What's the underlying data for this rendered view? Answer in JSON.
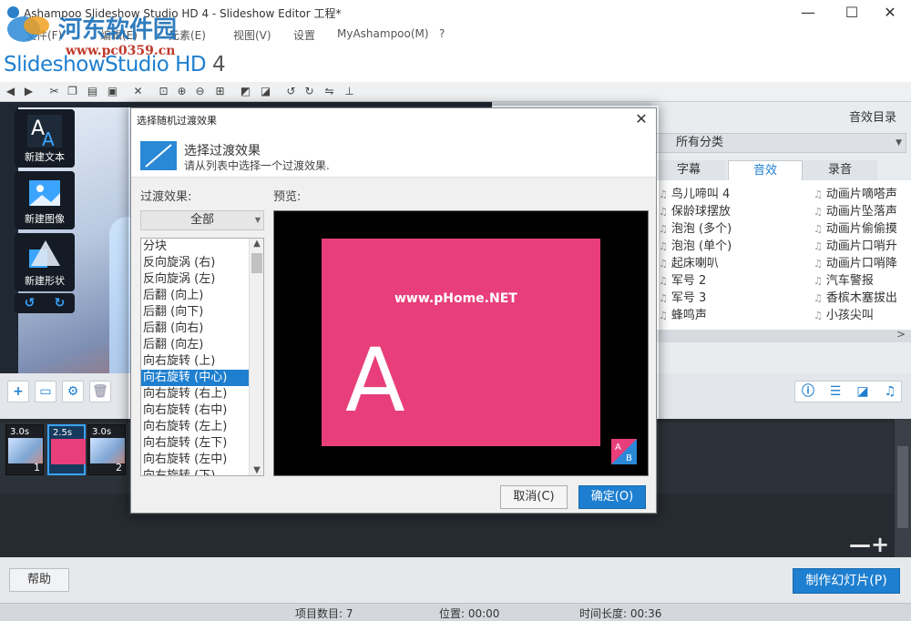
{
  "window": {
    "title": "Ashampoo Slideshow Studio HD 4 - Slideshow Editor 工程*",
    "min_glyph": "—",
    "max_glyph": "☐",
    "close_glyph": "✕"
  },
  "watermark": {
    "site": "河东软件园",
    "url": "www.pc0359.cn"
  },
  "menu": [
    "文件(F)",
    "编辑(E)",
    "元素(E)",
    "视图(V)",
    "设置",
    "MyAshampoo(M)",
    "?"
  ],
  "brand": {
    "name": "SlideshowStudio HD",
    "version": "4"
  },
  "left_tools": {
    "new_text": "新建文本",
    "new_image": "新建图像",
    "new_shape": "新建形状"
  },
  "right_panel": {
    "title": "音效目录",
    "category": "所有分类",
    "tabs": [
      "字幕",
      "音效",
      "录音"
    ],
    "active_tab": "音效",
    "col1": [
      "鸟儿啼叫 4",
      "保龄球摆放",
      "泡泡 (多个)",
      "泡泡 (单个)",
      "起床喇叭",
      "军号 2",
      "军号 3",
      "蜂鸣声"
    ],
    "col2": [
      "动画片嘀嗒声",
      "动画片坠落声",
      "动画片偷偷摸",
      "动画片口哨升",
      "动画片口哨降",
      "汽车警报",
      "香槟木塞拔出",
      "小孩尖叫"
    ],
    "scroll_arrow": ">"
  },
  "timeline": {
    "clips": [
      {
        "duration": "3.0s",
        "number": "1"
      },
      {
        "duration": "2.5s",
        "number": ""
      },
      {
        "duration": "3.0s",
        "number": "2"
      }
    ],
    "zoom_out": "—",
    "zoom_in": "+"
  },
  "bottom": {
    "help": "帮助",
    "make": "制作幻灯片(P)"
  },
  "status": {
    "items": "项目数目: 7",
    "position": "位置: 00:00",
    "duration": "时间长度: 00:36"
  },
  "dialog": {
    "title": "选择随机过渡效果",
    "close_glyph": "✕",
    "heading": "选择过渡效果",
    "subheading": "请从列表中选择一个过渡效果.",
    "effects_label": "过渡效果:",
    "preview_label": "预览:",
    "filter": "全部",
    "effects": [
      "分块",
      "反向旋涡 (右)",
      "反向旋涡 (左)",
      "后翻 (向上)",
      "后翻 (向下)",
      "后翻 (向右)",
      "后翻 (向左)",
      "向右旋转 (上)",
      "向右旋转 (中心)",
      "向右旋转 (右上)",
      "向右旋转 (右中)",
      "向右旋转 (左上)",
      "向右旋转 (左下)",
      "向右旋转 (左中)",
      "向右旋转 (下)"
    ],
    "selected_effect": "向右旋转 (中心)",
    "preview_letter": "A",
    "preview_watermark": "www.pHome.NET",
    "badge_a": "A",
    "badge_b": "B",
    "cancel": "取消(C)",
    "ok": "确定(O)"
  },
  "colors": {
    "accent": "#1e7fd0",
    "preview_card": "#e83f7b"
  }
}
